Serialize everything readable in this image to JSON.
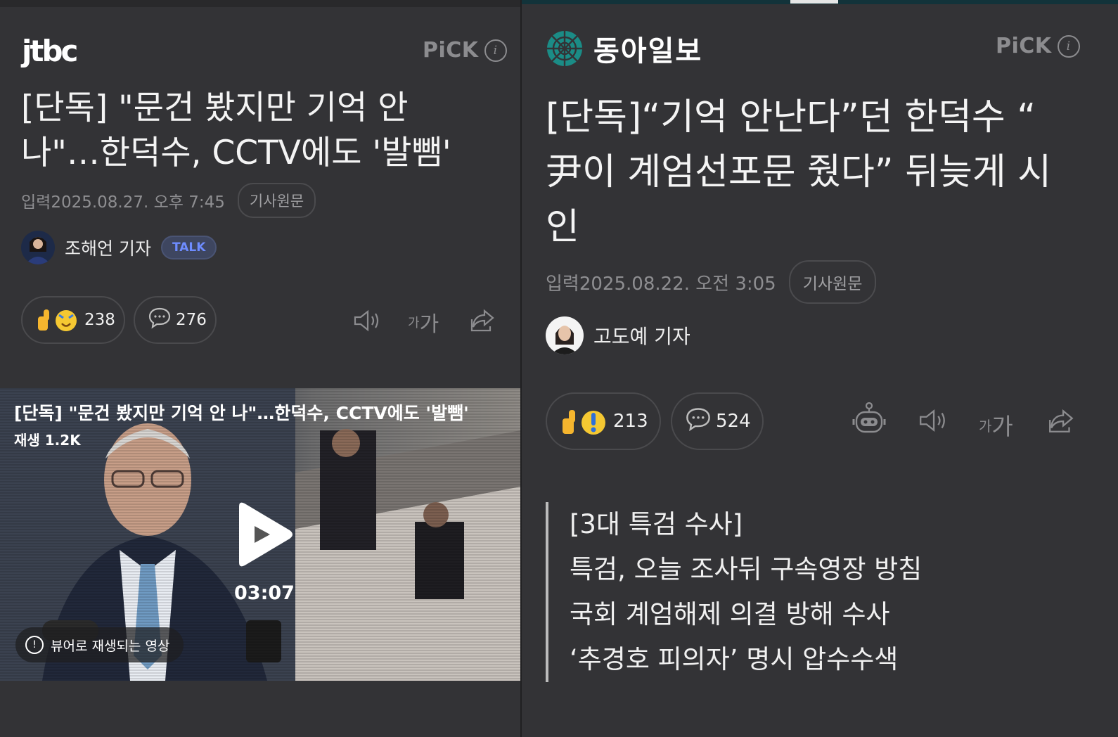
{
  "left": {
    "logo_text": "jtbc",
    "pick": "PiCK",
    "headline_line1": "[단독] \"문건 봤지만 기억 안",
    "headline_line2": "나\"…한덕수, CCTV에도 '발뺌'",
    "date": "입력2025.08.27. 오후 7:45",
    "original_link": "기사원문",
    "reporter": "조해언 기자",
    "talk_label": "TALK",
    "reaction_count": "238",
    "comment_count": "276",
    "font_label_small": "가",
    "font_label_big": "가",
    "video": {
      "title": "[단독] \"문건 봤지만 기억 안 나\"…한덕수, CCTV에도 '발뺌'",
      "plays": "재생 1.2K",
      "duration": "03:07",
      "note": "뷰어로 재생되는 영상"
    }
  },
  "right": {
    "logo_text": "동아일보",
    "pick": "PiCK",
    "headline_line1": "[단독]“기억 안난다”던 한덕수 “",
    "headline_line2": "尹이 계엄선포문 줬다” 뒤늦게 시",
    "headline_line3": "인",
    "date": "입력2025.08.22. 오전 3:05",
    "original_link": "기사원문",
    "reporter": "고도예 기자",
    "reaction_count": "213",
    "comment_count": "524",
    "font_label_small": "가",
    "font_label_big": "가",
    "summary": [
      "[3대 특검 수사]",
      "특검, 오늘 조사뒤 구속영장 방침",
      "국회 계엄해제 의결 방해 수사",
      "‘추경호 피의자’ 명시 압수수색"
    ]
  },
  "colors": {
    "background": "#333336",
    "muted": "#8c8c8f",
    "talk_accent": "#6e8cff",
    "donga_logo": "#1b8c86"
  }
}
